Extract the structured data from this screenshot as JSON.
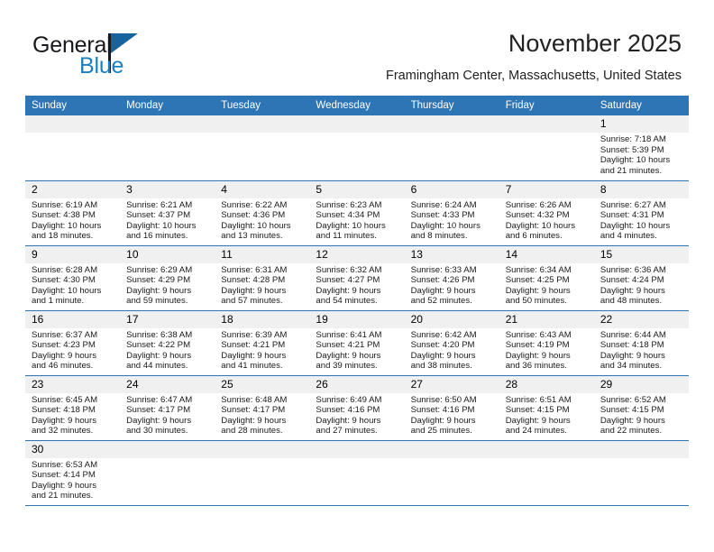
{
  "brand": {
    "name_part1": "General",
    "name_part2": "Blue",
    "flag_icon": "flag-triangle-icon",
    "accent_color": "#1a7fc1"
  },
  "header": {
    "title": "November 2025",
    "subtitle": "Framingham Center, Massachusetts, United States"
  },
  "theme": {
    "header_row_bg": "#2e75b6",
    "daynum_bg": "#f0f0f0",
    "grid_line": "#2e75b6",
    "text": "#1a1a1a"
  },
  "weekdays": [
    "Sunday",
    "Monday",
    "Tuesday",
    "Wednesday",
    "Thursday",
    "Friday",
    "Saturday"
  ],
  "labels": {
    "sunrise_prefix": "Sunrise:",
    "sunset_prefix": "Sunset:",
    "daylight_prefix": "Daylight:"
  },
  "weeks": [
    [
      {
        "day": "",
        "empty": true
      },
      {
        "day": "",
        "empty": true
      },
      {
        "day": "",
        "empty": true
      },
      {
        "day": "",
        "empty": true
      },
      {
        "day": "",
        "empty": true
      },
      {
        "day": "",
        "empty": true
      },
      {
        "day": "1",
        "sunrise": "Sunrise: 7:18 AM",
        "sunset": "Sunset: 5:39 PM",
        "daylight_line1": "Daylight: 10 hours",
        "daylight_line2": "and 21 minutes."
      }
    ],
    [
      {
        "day": "2",
        "sunrise": "Sunrise: 6:19 AM",
        "sunset": "Sunset: 4:38 PM",
        "daylight_line1": "Daylight: 10 hours",
        "daylight_line2": "and 18 minutes."
      },
      {
        "day": "3",
        "sunrise": "Sunrise: 6:21 AM",
        "sunset": "Sunset: 4:37 PM",
        "daylight_line1": "Daylight: 10 hours",
        "daylight_line2": "and 16 minutes."
      },
      {
        "day": "4",
        "sunrise": "Sunrise: 6:22 AM",
        "sunset": "Sunset: 4:36 PM",
        "daylight_line1": "Daylight: 10 hours",
        "daylight_line2": "and 13 minutes."
      },
      {
        "day": "5",
        "sunrise": "Sunrise: 6:23 AM",
        "sunset": "Sunset: 4:34 PM",
        "daylight_line1": "Daylight: 10 hours",
        "daylight_line2": "and 11 minutes."
      },
      {
        "day": "6",
        "sunrise": "Sunrise: 6:24 AM",
        "sunset": "Sunset: 4:33 PM",
        "daylight_line1": "Daylight: 10 hours",
        "daylight_line2": "and 8 minutes."
      },
      {
        "day": "7",
        "sunrise": "Sunrise: 6:26 AM",
        "sunset": "Sunset: 4:32 PM",
        "daylight_line1": "Daylight: 10 hours",
        "daylight_line2": "and 6 minutes."
      },
      {
        "day": "8",
        "sunrise": "Sunrise: 6:27 AM",
        "sunset": "Sunset: 4:31 PM",
        "daylight_line1": "Daylight: 10 hours",
        "daylight_line2": "and 4 minutes."
      }
    ],
    [
      {
        "day": "9",
        "sunrise": "Sunrise: 6:28 AM",
        "sunset": "Sunset: 4:30 PM",
        "daylight_line1": "Daylight: 10 hours",
        "daylight_line2": "and 1 minute."
      },
      {
        "day": "10",
        "sunrise": "Sunrise: 6:29 AM",
        "sunset": "Sunset: 4:29 PM",
        "daylight_line1": "Daylight: 9 hours",
        "daylight_line2": "and 59 minutes."
      },
      {
        "day": "11",
        "sunrise": "Sunrise: 6:31 AM",
        "sunset": "Sunset: 4:28 PM",
        "daylight_line1": "Daylight: 9 hours",
        "daylight_line2": "and 57 minutes."
      },
      {
        "day": "12",
        "sunrise": "Sunrise: 6:32 AM",
        "sunset": "Sunset: 4:27 PM",
        "daylight_line1": "Daylight: 9 hours",
        "daylight_line2": "and 54 minutes."
      },
      {
        "day": "13",
        "sunrise": "Sunrise: 6:33 AM",
        "sunset": "Sunset: 4:26 PM",
        "daylight_line1": "Daylight: 9 hours",
        "daylight_line2": "and 52 minutes."
      },
      {
        "day": "14",
        "sunrise": "Sunrise: 6:34 AM",
        "sunset": "Sunset: 4:25 PM",
        "daylight_line1": "Daylight: 9 hours",
        "daylight_line2": "and 50 minutes."
      },
      {
        "day": "15",
        "sunrise": "Sunrise: 6:36 AM",
        "sunset": "Sunset: 4:24 PM",
        "daylight_line1": "Daylight: 9 hours",
        "daylight_line2": "and 48 minutes."
      }
    ],
    [
      {
        "day": "16",
        "sunrise": "Sunrise: 6:37 AM",
        "sunset": "Sunset: 4:23 PM",
        "daylight_line1": "Daylight: 9 hours",
        "daylight_line2": "and 46 minutes."
      },
      {
        "day": "17",
        "sunrise": "Sunrise: 6:38 AM",
        "sunset": "Sunset: 4:22 PM",
        "daylight_line1": "Daylight: 9 hours",
        "daylight_line2": "and 44 minutes."
      },
      {
        "day": "18",
        "sunrise": "Sunrise: 6:39 AM",
        "sunset": "Sunset: 4:21 PM",
        "daylight_line1": "Daylight: 9 hours",
        "daylight_line2": "and 41 minutes."
      },
      {
        "day": "19",
        "sunrise": "Sunrise: 6:41 AM",
        "sunset": "Sunset: 4:21 PM",
        "daylight_line1": "Daylight: 9 hours",
        "daylight_line2": "and 39 minutes."
      },
      {
        "day": "20",
        "sunrise": "Sunrise: 6:42 AM",
        "sunset": "Sunset: 4:20 PM",
        "daylight_line1": "Daylight: 9 hours",
        "daylight_line2": "and 38 minutes."
      },
      {
        "day": "21",
        "sunrise": "Sunrise: 6:43 AM",
        "sunset": "Sunset: 4:19 PM",
        "daylight_line1": "Daylight: 9 hours",
        "daylight_line2": "and 36 minutes."
      },
      {
        "day": "22",
        "sunrise": "Sunrise: 6:44 AM",
        "sunset": "Sunset: 4:18 PM",
        "daylight_line1": "Daylight: 9 hours",
        "daylight_line2": "and 34 minutes."
      }
    ],
    [
      {
        "day": "23",
        "sunrise": "Sunrise: 6:45 AM",
        "sunset": "Sunset: 4:18 PM",
        "daylight_line1": "Daylight: 9 hours",
        "daylight_line2": "and 32 minutes."
      },
      {
        "day": "24",
        "sunrise": "Sunrise: 6:47 AM",
        "sunset": "Sunset: 4:17 PM",
        "daylight_line1": "Daylight: 9 hours",
        "daylight_line2": "and 30 minutes."
      },
      {
        "day": "25",
        "sunrise": "Sunrise: 6:48 AM",
        "sunset": "Sunset: 4:17 PM",
        "daylight_line1": "Daylight: 9 hours",
        "daylight_line2": "and 28 minutes."
      },
      {
        "day": "26",
        "sunrise": "Sunrise: 6:49 AM",
        "sunset": "Sunset: 4:16 PM",
        "daylight_line1": "Daylight: 9 hours",
        "daylight_line2": "and 27 minutes."
      },
      {
        "day": "27",
        "sunrise": "Sunrise: 6:50 AM",
        "sunset": "Sunset: 4:16 PM",
        "daylight_line1": "Daylight: 9 hours",
        "daylight_line2": "and 25 minutes."
      },
      {
        "day": "28",
        "sunrise": "Sunrise: 6:51 AM",
        "sunset": "Sunset: 4:15 PM",
        "daylight_line1": "Daylight: 9 hours",
        "daylight_line2": "and 24 minutes."
      },
      {
        "day": "29",
        "sunrise": "Sunrise: 6:52 AM",
        "sunset": "Sunset: 4:15 PM",
        "daylight_line1": "Daylight: 9 hours",
        "daylight_line2": "and 22 minutes."
      }
    ],
    [
      {
        "day": "30",
        "sunrise": "Sunrise: 6:53 AM",
        "sunset": "Sunset: 4:14 PM",
        "daylight_line1": "Daylight: 9 hours",
        "daylight_line2": "and 21 minutes."
      },
      {
        "day": "",
        "empty": true
      },
      {
        "day": "",
        "empty": true
      },
      {
        "day": "",
        "empty": true
      },
      {
        "day": "",
        "empty": true
      },
      {
        "day": "",
        "empty": true
      },
      {
        "day": "",
        "empty": true
      }
    ]
  ]
}
